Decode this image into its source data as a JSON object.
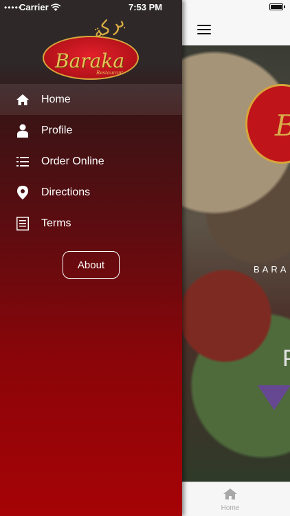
{
  "status_bar": {
    "signal": "•••••",
    "carrier": "Carrier",
    "time": "7:53 PM"
  },
  "logo": {
    "name": "Baraka",
    "sub": "Restaurant"
  },
  "menu": {
    "items": [
      {
        "label": "Home",
        "icon": "home-icon",
        "active": true
      },
      {
        "label": "Profile",
        "icon": "person-icon",
        "active": false
      },
      {
        "label": "Order Online",
        "icon": "list-icon",
        "active": false
      },
      {
        "label": "Directions",
        "icon": "location-pin-icon",
        "active": false
      },
      {
        "label": "Terms",
        "icon": "document-icon",
        "active": false
      }
    ],
    "about_label": "About"
  },
  "background_screen": {
    "hero_caption": "BARA",
    "hero_letter": "P",
    "tab_home_label": "Home"
  },
  "colors": {
    "drawer_top": "#2e2829",
    "drawer_bottom": "#a60306",
    "logo_gold": "#e8c15a",
    "logo_red": "#c0141b"
  }
}
